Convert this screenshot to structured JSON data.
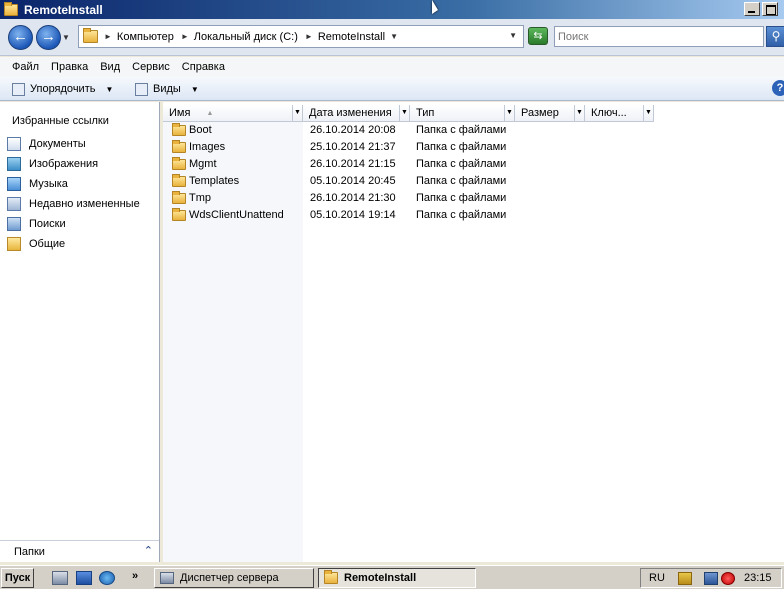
{
  "window": {
    "title": "RemoteInstall"
  },
  "address": {
    "crumbs": [
      "Компьютер",
      "Локальный диск (C:)",
      "RemoteInstall"
    ],
    "search_placeholder": "Поиск"
  },
  "menu": [
    "Файл",
    "Правка",
    "Вид",
    "Сервис",
    "Справка"
  ],
  "toolbar": {
    "organize": "Упорядочить",
    "views": "Виды"
  },
  "navpane": {
    "heading": "Избранные ссылки",
    "items": [
      "Документы",
      "Изображения",
      "Музыка",
      "Недавно измененные",
      "Поиски",
      "Общие"
    ],
    "folders_label": "Папки"
  },
  "columns": [
    "Имя",
    "Дата изменения",
    "Тип",
    "Размер",
    "Ключ..."
  ],
  "files": [
    {
      "name": "Boot",
      "date": "26.10.2014 20:08",
      "type": "Папка с файлами"
    },
    {
      "name": "Images",
      "date": "25.10.2014 21:37",
      "type": "Папка с файлами"
    },
    {
      "name": "Mgmt",
      "date": "26.10.2014 21:15",
      "type": "Папка с файлами"
    },
    {
      "name": "Templates",
      "date": "05.10.2014 20:45",
      "type": "Папка с файлами"
    },
    {
      "name": "Tmp",
      "date": "26.10.2014 21:30",
      "type": "Папка с файлами"
    },
    {
      "name": "WdsClientUnattend",
      "date": "05.10.2014 19:14",
      "type": "Папка с файлами"
    }
  ],
  "taskbar": {
    "start": "Пуск",
    "tasks": [
      "Диспетчер сервера",
      "RemoteInstall"
    ],
    "lang": "RU",
    "clock": "23:15"
  }
}
